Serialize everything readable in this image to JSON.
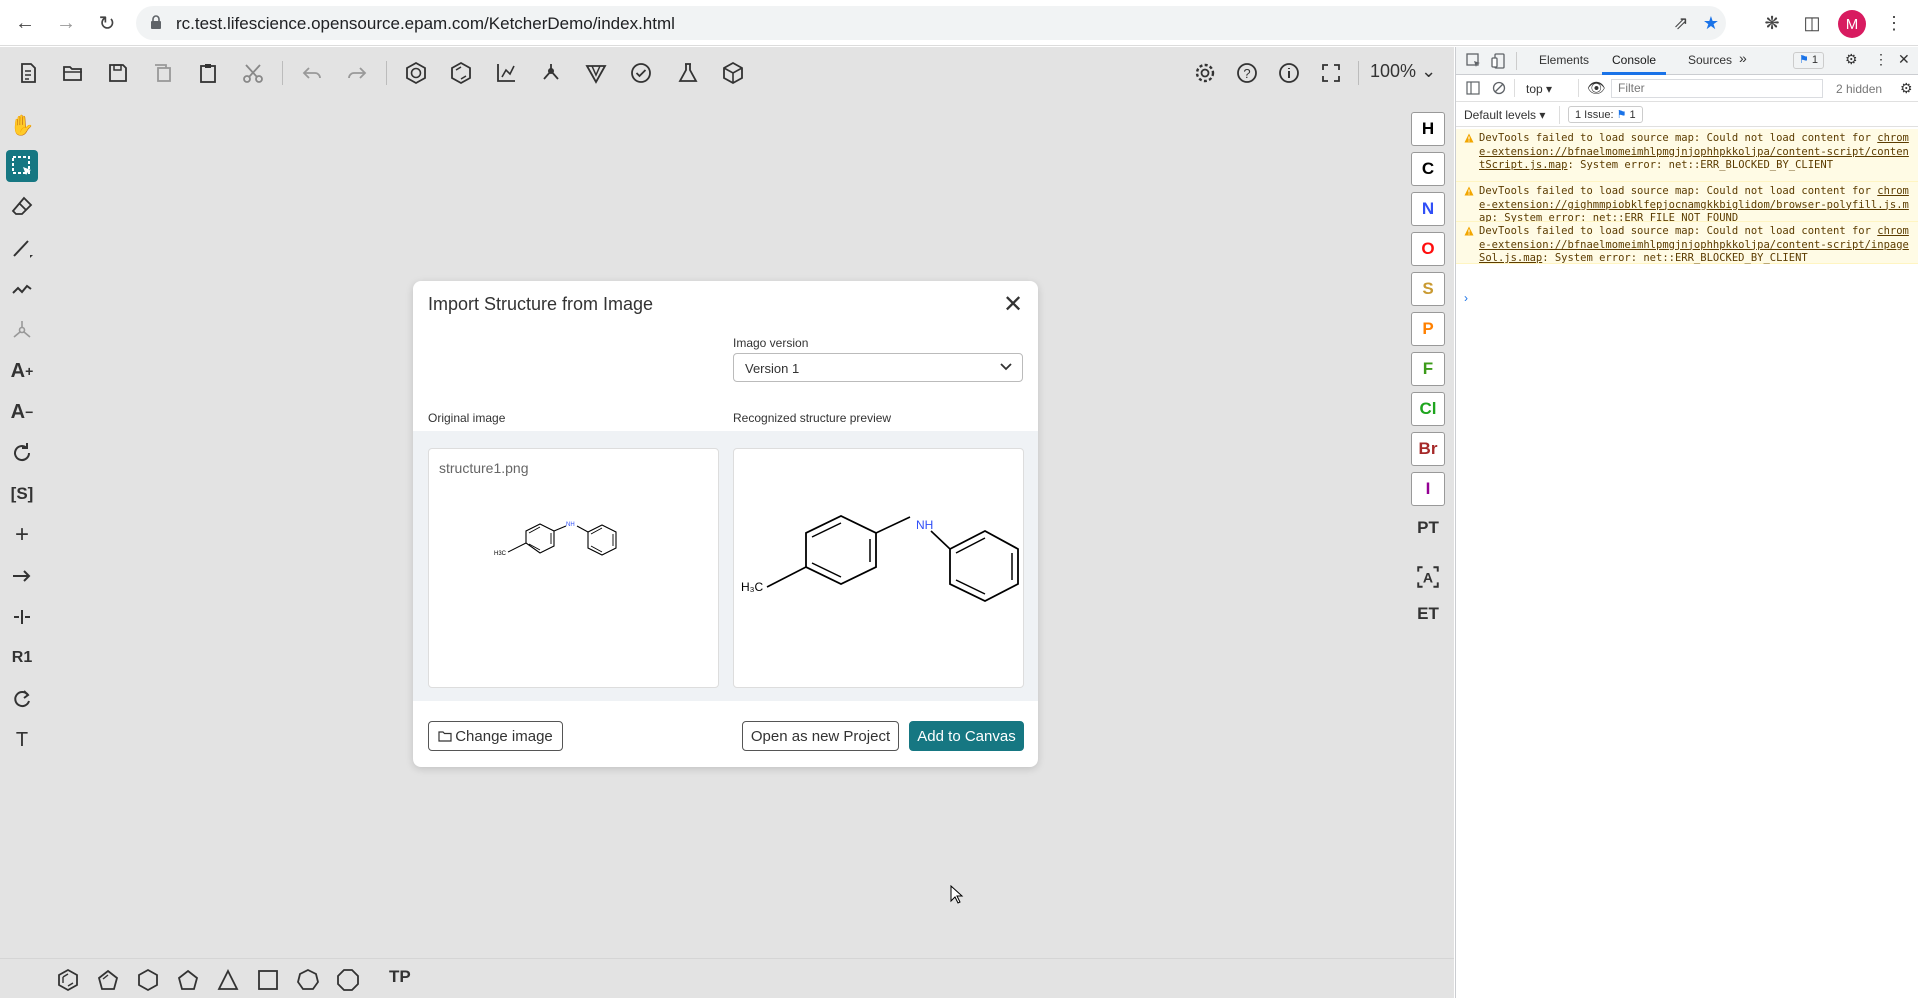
{
  "browser": {
    "url_host": "rc.test.lifescience.opensource.epam.com",
    "url_path": "/KetcherDemo/index.html",
    "avatar_letter": "M"
  },
  "ketcher": {
    "zoom": "100%",
    "atoms": [
      {
        "symbol": "H",
        "color": "#000000"
      },
      {
        "symbol": "C",
        "color": "#000000"
      },
      {
        "symbol": "N",
        "color": "#304ff7"
      },
      {
        "symbol": "O",
        "color": "#ff0d0d"
      },
      {
        "symbol": "S",
        "color": "#c99a32"
      },
      {
        "symbol": "P",
        "color": "#ff8000"
      },
      {
        "symbol": "F",
        "color": "#78bc42"
      },
      {
        "symbol": "Cl",
        "color": "#1ff01f"
      },
      {
        "symbol": "Br",
        "color": "#a62929"
      },
      {
        "symbol": "I",
        "color": "#940094"
      }
    ],
    "right_labels": {
      "pt": "PT",
      "et": "ET"
    },
    "bottom_label": "TP",
    "left_labels": {
      "r1": "R1",
      "s": "[S]",
      "t": "T"
    }
  },
  "dialog": {
    "title": "Import Structure from Image",
    "version_label": "Imago version",
    "version_value": "Version 1",
    "original_label": "Original image",
    "preview_label": "Recognized structure preview",
    "filename": "structure1.png",
    "change_image": "Change image",
    "open_new": "Open as new Project",
    "add_canvas": "Add to Canvas",
    "molecule": {
      "nh": "NH",
      "methyl": "H₃C"
    }
  },
  "devtools": {
    "tabs": [
      "Elements",
      "Console",
      "Sources"
    ],
    "issues_count": "1",
    "context": "top",
    "filter_placeholder": "Filter",
    "hidden": "2 hidden",
    "levels": "Default levels",
    "issue_badge": "1 Issue:",
    "issue_badge_count": "1",
    "messages": [
      {
        "prefix": "DevTools failed to load source map: Could not load content for ",
        "link": "chrome-extension://bfnaelmomeimhlpmgjnjophhpkkoljpa/content-script/contentScript.js.map",
        "suffix": ": System error: net::ERR_BLOCKED_BY_CLIENT"
      },
      {
        "prefix": "DevTools failed to load source map: Could not load content for ",
        "link": "chrome-extension://gighmmpiobklfepjocnamgkkbiglidom/browser-polyfill.js.map",
        "suffix": ": System error: net::ERR_FILE_NOT_FOUND"
      },
      {
        "prefix": "DevTools failed to load source map: Could not load content for ",
        "link": "chrome-extension://bfnaelmomeimhlpmgjnjophhpkkoljpa/content-script/inpageSol.js.map",
        "suffix": ": System error: net::ERR_BLOCKED_BY_CLIENT"
      }
    ]
  }
}
